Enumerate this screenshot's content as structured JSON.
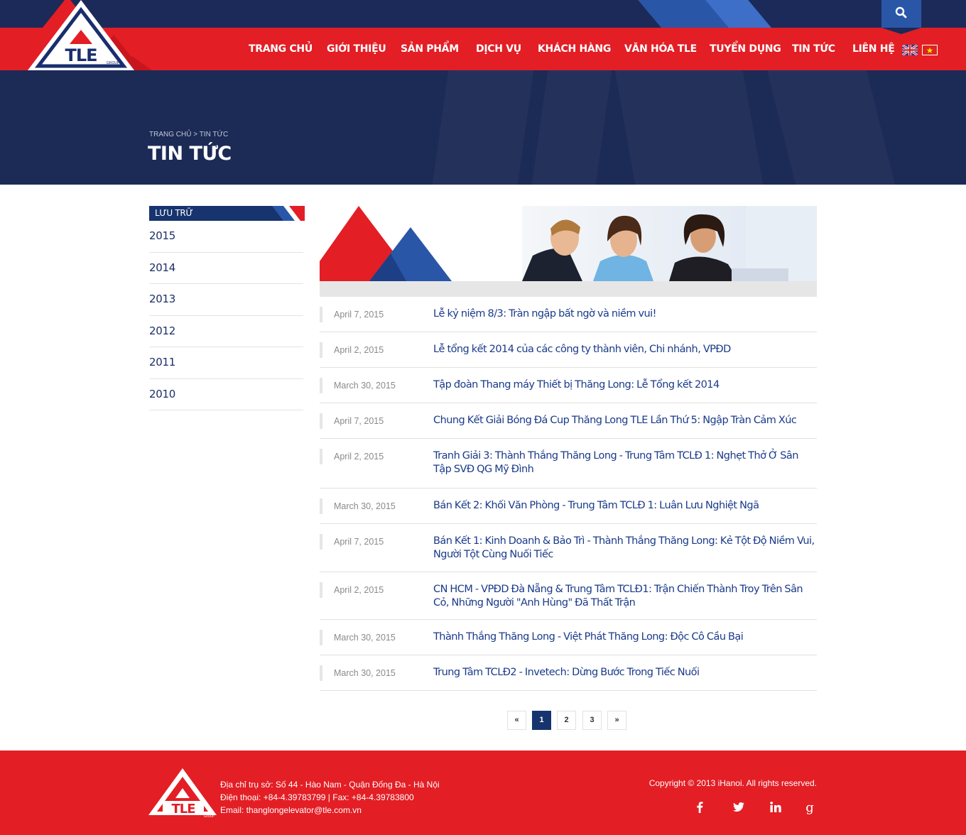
{
  "header": {
    "nav": [
      {
        "label": "TRANG CHỦ"
      },
      {
        "label": "GIỚI THIỆU"
      },
      {
        "label": "SẢN PHẨM"
      },
      {
        "label": "DỊCH VỤ"
      },
      {
        "label": "KHÁCH HÀNG"
      },
      {
        "label": "VĂN HÓA TLE"
      },
      {
        "label": "TUYỂN DỤNG"
      },
      {
        "label": "TIN TỨC"
      },
      {
        "label": "LIÊN HỆ"
      }
    ],
    "logo_text": "TLE",
    "logo_sub": "GROUP",
    "colors": {
      "red": "#e31e25",
      "navy": "#1b2a58",
      "blue": "#2a56a8"
    }
  },
  "hero": {
    "breadcrumb_home": "TRANG CHỦ",
    "breadcrumb_sep": ">",
    "breadcrumb_current": "TIN TỨC",
    "title": "TIN TỨC"
  },
  "sidebar": {
    "heading": "LƯU TRỮ",
    "years": [
      "2015",
      "2014",
      "2013",
      "2012",
      "2011",
      "2010"
    ]
  },
  "news": [
    {
      "date": "April 7, 2015",
      "title": "Lễ kỷ niệm 8/3: Tràn ngập bất ngờ và niềm vui!"
    },
    {
      "date": "April 2, 2015",
      "title": "Lễ tổng kết 2014 của các công ty thành viên, Chi nhánh, VPĐD"
    },
    {
      "date": "March 30, 2015",
      "title": "Tập đoàn Thang máy Thiết bị Thăng Long: Lễ Tổng kết 2014"
    },
    {
      "date": "April 7, 2015",
      "title": "Chung Kết Giải Bóng Đá Cup Thăng Long TLE Lần Thứ 5: Ngập Tràn Cảm Xúc"
    },
    {
      "date": "April 2, 2015",
      "title": "Tranh Giải 3: Thành Thắng Thăng Long - Trung Tâm TCLĐ 1: Nghẹt Thở Ở Sân Tập SVĐ QG Mỹ Đình"
    },
    {
      "date": "March 30, 2015",
      "title": "Bán Kết 2: Khối Văn Phòng - Trung Tâm TCLĐ 1: Luân Lưu Nghiệt Ngã"
    },
    {
      "date": "April 7, 2015",
      "title": "Bán Kết 1: Kinh Doanh & Bảo Trì - Thành Thắng Thăng Long: Kẻ Tột Độ Niềm Vui, Người Tột Cùng Nuối Tiếc"
    },
    {
      "date": "April 2, 2015",
      "title": "CN HCM - VPĐD Đà Nẵng & Trung Tâm TCLĐ1: Trận Chiến Thành Troy Trên Sân Cỏ, Những Người \"Anh Hùng\" Đã Thất Trận"
    },
    {
      "date": "March 30, 2015",
      "title": "Thành Thắng Thăng Long - Việt Phát Thăng Long: Độc Cô Cầu Bại"
    },
    {
      "date": "March 30, 2015",
      "title": "Trung Tâm TCLĐ2 - Invetech: Dừng Bước Trong Tiếc Nuối"
    }
  ],
  "pager": {
    "prev": "«",
    "pages": [
      "1",
      "2",
      "3"
    ],
    "next": "»",
    "current": "1"
  },
  "footer": {
    "address": "Địa chỉ trụ sở: Số 44 - Hào Nam - Quận Đống Đa - Hà Nội",
    "phone": "Điện thoại:  +84-4.39783799  |  Fax: +84-4.39783800",
    "email": "Email: thanglongelevator@tle.com.vn",
    "copyright": "Copyright © 2013 iHanoi. All rights reserved.",
    "social": [
      "facebook-icon",
      "twitter-icon",
      "linkedin-icon",
      "google-plus-icon"
    ]
  }
}
